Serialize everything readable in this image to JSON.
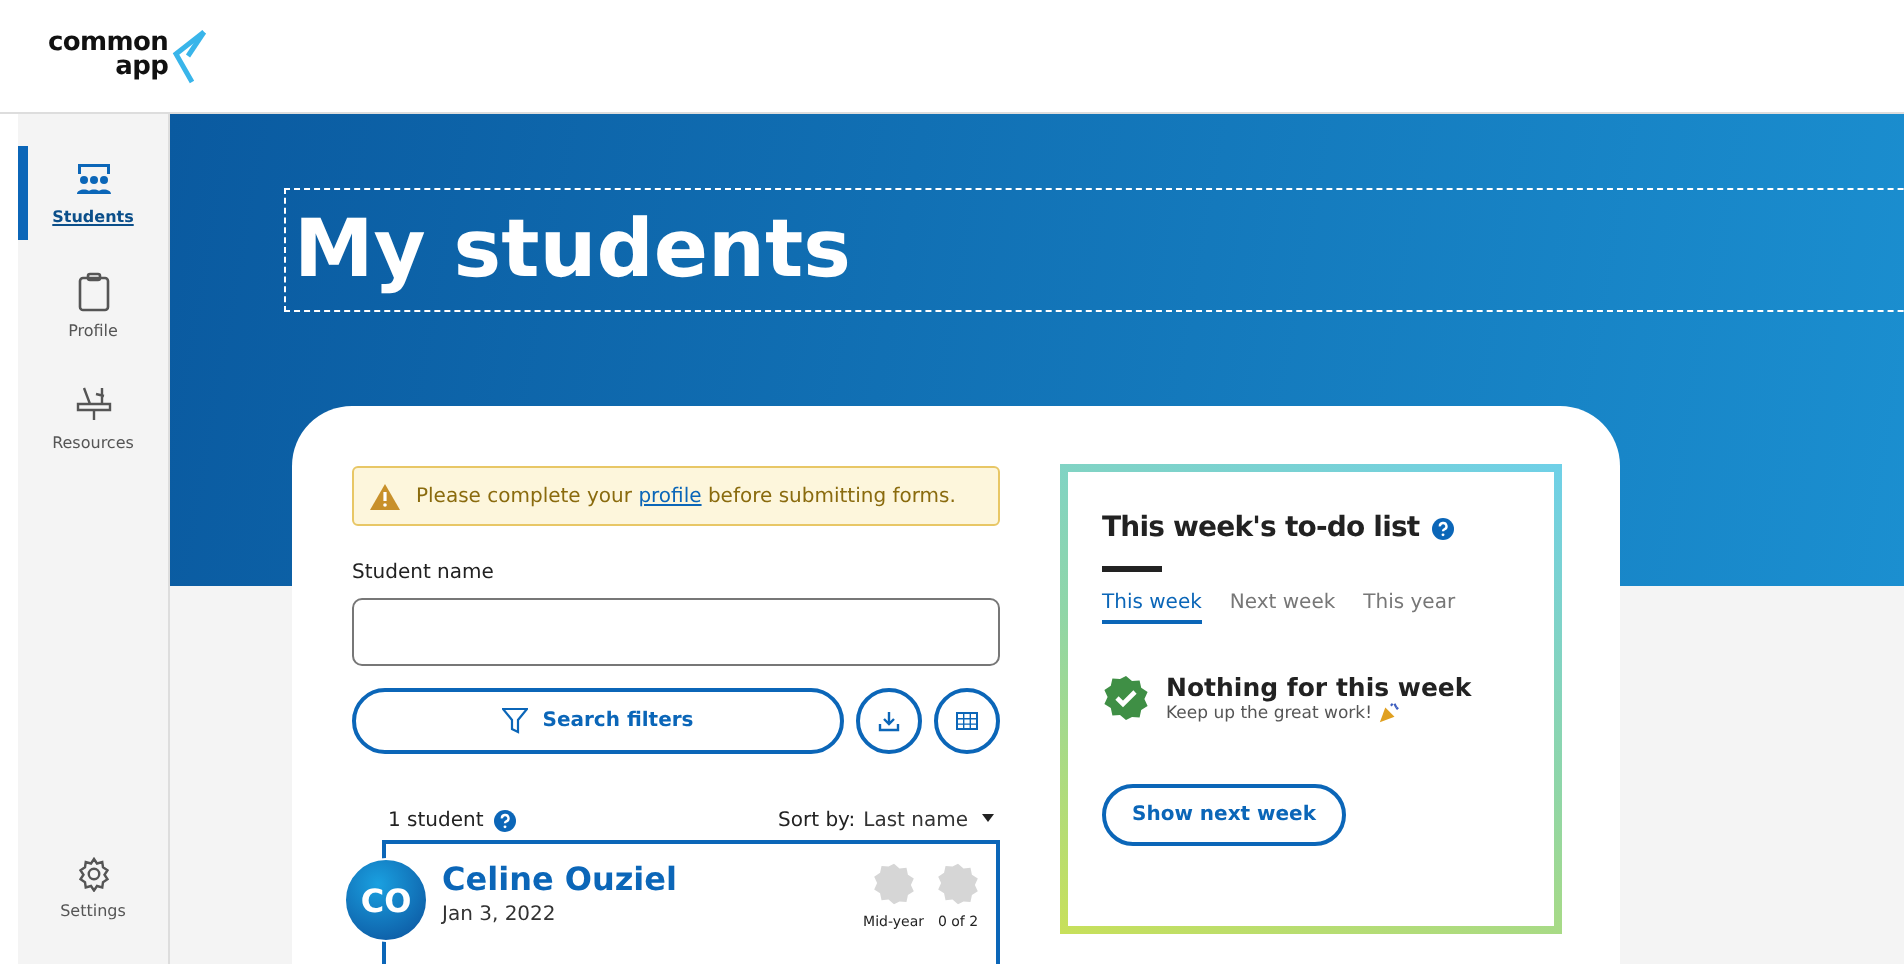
{
  "logo": {
    "line_1": "common",
    "line_2": "app"
  },
  "sidebar": {
    "items": [
      {
        "label": "Students",
        "selected": true,
        "kind": "students"
      },
      {
        "label": "Profile",
        "selected": false,
        "kind": "profile"
      },
      {
        "label": "Resources",
        "selected": false,
        "kind": "resources"
      }
    ],
    "footer_item": {
      "label": "Settings",
      "selected": false,
      "kind": "settings"
    }
  },
  "hero": {
    "title": "My students"
  },
  "alert": {
    "text": "Please complete your ",
    "link": "profile",
    "text_after": " before submitting forms."
  },
  "search": {
    "label": "Student name"
  },
  "filters_button": "Search filters",
  "results": {
    "count": "1 student",
    "sort_label": "Sort by:",
    "sort_value": "Last name"
  },
  "students": [
    {
      "initials": "CO",
      "name": "Celine Ouziel",
      "date": "Jan 3, 2022",
      "badges": [
        {
          "label": "Mid-year"
        },
        {
          "label": "0 of 2"
        }
      ]
    }
  ],
  "todo": {
    "title": "This week's to-do list",
    "tabs": [
      {
        "label": "This week",
        "selected": true
      },
      {
        "label": "Next week",
        "selected": false
      },
      {
        "label": "This year",
        "selected": false
      }
    ],
    "empty_title": "Nothing for this week",
    "empty_text": "Keep up the great work!",
    "button": "Show next week"
  }
}
